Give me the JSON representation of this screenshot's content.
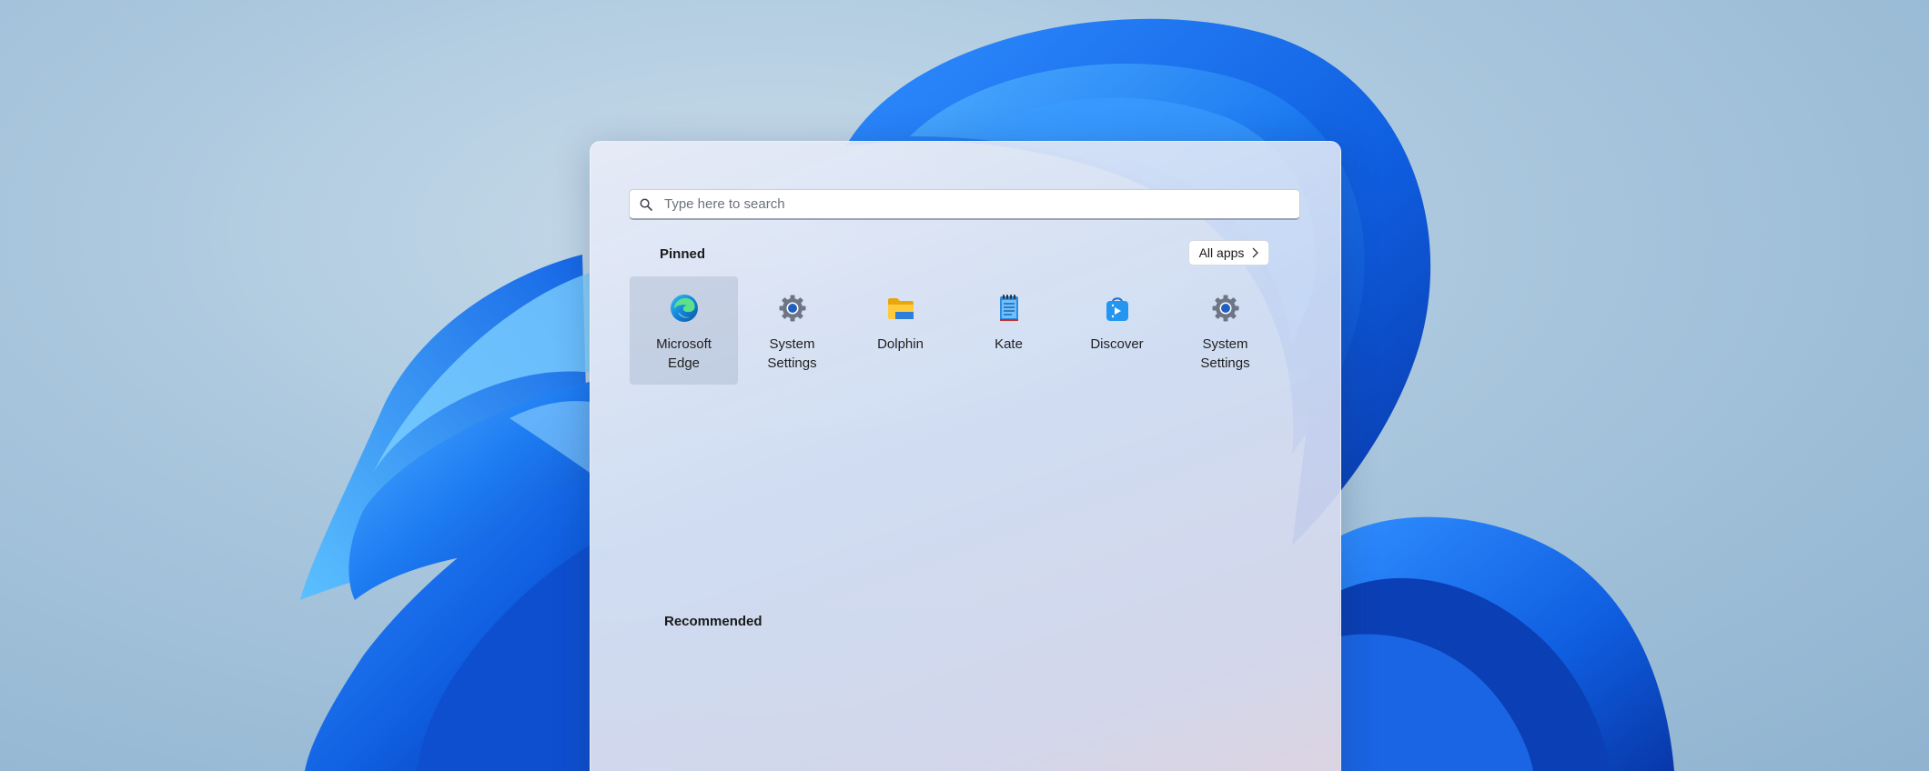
{
  "search": {
    "placeholder": "Type here to search",
    "icon": "search-icon"
  },
  "pinned": {
    "title": "Pinned",
    "all_apps_label": "All apps",
    "apps": [
      {
        "label": "Microsoft Edge",
        "icon": "edge-icon",
        "selected": true
      },
      {
        "label": "System Settings",
        "icon": "settings-gear-icon",
        "selected": false
      },
      {
        "label": "Dolphin",
        "icon": "folder-icon",
        "selected": false
      },
      {
        "label": "Kate",
        "icon": "notepad-icon",
        "selected": false
      },
      {
        "label": "Discover",
        "icon": "store-bag-icon",
        "selected": false
      },
      {
        "label": "System Settings",
        "icon": "settings-gear-icon",
        "selected": false
      }
    ]
  },
  "recommended": {
    "title": "Recommended"
  },
  "colors": {
    "wallpaper_blue": "#1b6ef3",
    "accent": "#0067c0"
  }
}
